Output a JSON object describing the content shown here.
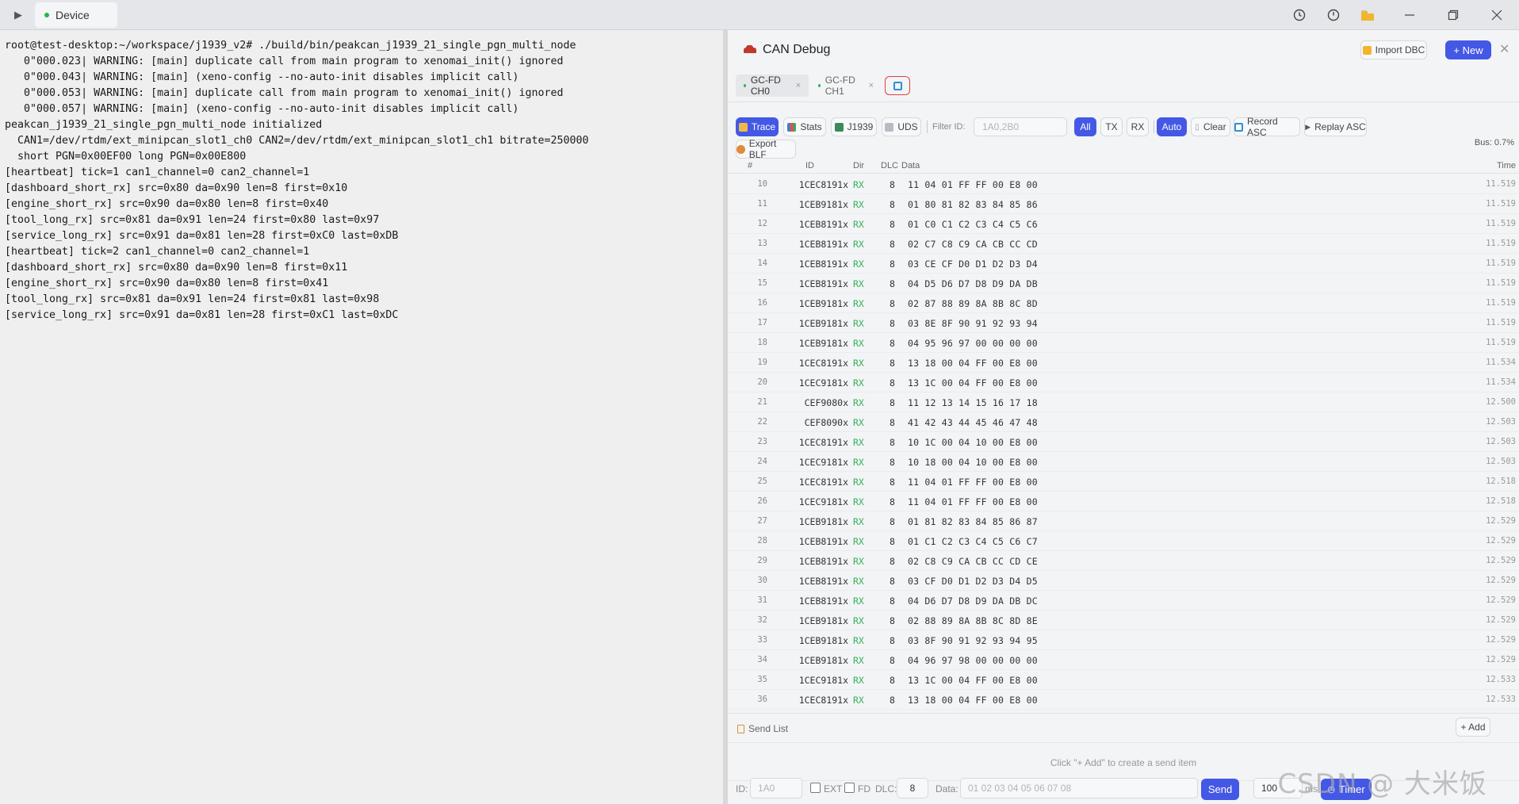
{
  "topbar": {
    "device_tab_label": "Device"
  },
  "terminal": {
    "lines": [
      "root@test-desktop:~/workspace/j1939_v2# ./build/bin/peakcan_j1939_21_single_pgn_multi_node",
      "   0\"000.023| WARNING: [main] duplicate call from main program to xenomai_init() ignored",
      "   0\"000.043| WARNING: [main] (xeno-config --no-auto-init disables implicit call)",
      "   0\"000.053| WARNING: [main] duplicate call from main program to xenomai_init() ignored",
      "   0\"000.057| WARNING: [main] (xeno-config --no-auto-init disables implicit call)",
      "peakcan_j1939_21_single_pgn_multi_node initialized",
      "  CAN1=/dev/rtdm/ext_minipcan_slot1_ch0 CAN2=/dev/rtdm/ext_minipcan_slot1_ch1 bitrate=250000",
      "  short PGN=0x00EF00 long PGN=0x00E800",
      "[heartbeat] tick=1 can1_channel=0 can2_channel=1",
      "[dashboard_short_rx] src=0x80 da=0x90 len=8 first=0x10",
      "[engine_short_rx] src=0x90 da=0x80 len=8 first=0x40",
      "[tool_long_rx] src=0x81 da=0x91 len=24 first=0x80 last=0x97",
      "[service_long_rx] src=0x91 da=0x81 len=28 first=0xC0 last=0xDB",
      "[heartbeat] tick=2 can1_channel=0 can2_channel=1",
      "[dashboard_short_rx] src=0x80 da=0x90 len=8 first=0x11",
      "[engine_short_rx] src=0x90 da=0x80 len=8 first=0x41",
      "[tool_long_rx] src=0x81 da=0x91 len=24 first=0x81 last=0x98",
      "[service_long_rx] src=0x91 da=0x81 len=28 first=0xC1 last=0xDC"
    ]
  },
  "panel": {
    "title": "CAN Debug",
    "import_dbc": "Import DBC",
    "new_btn": "+ New",
    "tabs": [
      {
        "label": "GC-FD CH0",
        "active": true
      },
      {
        "label": "GC-FD CH1",
        "active": false
      }
    ],
    "toolbar": {
      "trace": "Trace",
      "stats": "Stats",
      "j1939": "J1939",
      "uds": "UDS",
      "filter_label": "Filter ID:",
      "filter_placeholder": "1A0,2B0",
      "all": "All",
      "tx": "TX",
      "rx": "RX",
      "auto": "Auto",
      "clear": "Clear",
      "record_asc": "Record ASC",
      "replay_asc": "Replay ASC",
      "export_blf": "Export BLF",
      "bus_load": "Bus: 0.7%"
    },
    "table_headers": {
      "num": "#",
      "id": "ID",
      "dir": "Dir",
      "dlc": "DLC",
      "data": "Data",
      "time": "Time"
    },
    "rows": [
      {
        "n": "10",
        "id": "1CEC8191x",
        "dir": "RX",
        "dlc": "8",
        "data": "11 04 01 FF FF 00 E8 00",
        "time": "11.519"
      },
      {
        "n": "11",
        "id": "1CEB9181x",
        "dir": "RX",
        "dlc": "8",
        "data": "01 80 81 82 83 84 85 86",
        "time": "11.519"
      },
      {
        "n": "12",
        "id": "1CEB8191x",
        "dir": "RX",
        "dlc": "8",
        "data": "01 C0 C1 C2 C3 C4 C5 C6",
        "time": "11.519"
      },
      {
        "n": "13",
        "id": "1CEB8191x",
        "dir": "RX",
        "dlc": "8",
        "data": "02 C7 C8 C9 CA CB CC CD",
        "time": "11.519"
      },
      {
        "n": "14",
        "id": "1CEB8191x",
        "dir": "RX",
        "dlc": "8",
        "data": "03 CE CF D0 D1 D2 D3 D4",
        "time": "11.519"
      },
      {
        "n": "15",
        "id": "1CEB8191x",
        "dir": "RX",
        "dlc": "8",
        "data": "04 D5 D6 D7 D8 D9 DA DB",
        "time": "11.519"
      },
      {
        "n": "16",
        "id": "1CEB9181x",
        "dir": "RX",
        "dlc": "8",
        "data": "02 87 88 89 8A 8B 8C 8D",
        "time": "11.519"
      },
      {
        "n": "17",
        "id": "1CEB9181x",
        "dir": "RX",
        "dlc": "8",
        "data": "03 8E 8F 90 91 92 93 94",
        "time": "11.519"
      },
      {
        "n": "18",
        "id": "1CEB9181x",
        "dir": "RX",
        "dlc": "8",
        "data": "04 95 96 97 00 00 00 00",
        "time": "11.519"
      },
      {
        "n": "19",
        "id": "1CEC8191x",
        "dir": "RX",
        "dlc": "8",
        "data": "13 18 00 04 FF 00 E8 00",
        "time": "11.534"
      },
      {
        "n": "20",
        "id": "1CEC9181x",
        "dir": "RX",
        "dlc": "8",
        "data": "13 1C 00 04 FF 00 E8 00",
        "time": "11.534"
      },
      {
        "n": "21",
        "id": "CEF9080x",
        "dir": "RX",
        "dlc": "8",
        "data": "11 12 13 14 15 16 17 18",
        "time": "12.500"
      },
      {
        "n": "22",
        "id": "CEF8090x",
        "dir": "RX",
        "dlc": "8",
        "data": "41 42 43 44 45 46 47 48",
        "time": "12.503"
      },
      {
        "n": "23",
        "id": "1CEC8191x",
        "dir": "RX",
        "dlc": "8",
        "data": "10 1C 00 04 10 00 E8 00",
        "time": "12.503"
      },
      {
        "n": "24",
        "id": "1CEC9181x",
        "dir": "RX",
        "dlc": "8",
        "data": "10 18 00 04 10 00 E8 00",
        "time": "12.503"
      },
      {
        "n": "25",
        "id": "1CEC8191x",
        "dir": "RX",
        "dlc": "8",
        "data": "11 04 01 FF FF 00 E8 00",
        "time": "12.518"
      },
      {
        "n": "26",
        "id": "1CEC9181x",
        "dir": "RX",
        "dlc": "8",
        "data": "11 04 01 FF FF 00 E8 00",
        "time": "12.518"
      },
      {
        "n": "27",
        "id": "1CEB9181x",
        "dir": "RX",
        "dlc": "8",
        "data": "01 81 82 83 84 85 86 87",
        "time": "12.529"
      },
      {
        "n": "28",
        "id": "1CEB8191x",
        "dir": "RX",
        "dlc": "8",
        "data": "01 C1 C2 C3 C4 C5 C6 C7",
        "time": "12.529"
      },
      {
        "n": "29",
        "id": "1CEB8191x",
        "dir": "RX",
        "dlc": "8",
        "data": "02 C8 C9 CA CB CC CD CE",
        "time": "12.529"
      },
      {
        "n": "30",
        "id": "1CEB8191x",
        "dir": "RX",
        "dlc": "8",
        "data": "03 CF D0 D1 D2 D3 D4 D5",
        "time": "12.529"
      },
      {
        "n": "31",
        "id": "1CEB8191x",
        "dir": "RX",
        "dlc": "8",
        "data": "04 D6 D7 D8 D9 DA DB DC",
        "time": "12.529"
      },
      {
        "n": "32",
        "id": "1CEB9181x",
        "dir": "RX",
        "dlc": "8",
        "data": "02 88 89 8A 8B 8C 8D 8E",
        "time": "12.529"
      },
      {
        "n": "33",
        "id": "1CEB9181x",
        "dir": "RX",
        "dlc": "8",
        "data": "03 8F 90 91 92 93 94 95",
        "time": "12.529"
      },
      {
        "n": "34",
        "id": "1CEB9181x",
        "dir": "RX",
        "dlc": "8",
        "data": "04 96 97 98 00 00 00 00",
        "time": "12.529"
      },
      {
        "n": "35",
        "id": "1CEC9181x",
        "dir": "RX",
        "dlc": "8",
        "data": "13 1C 00 04 FF 00 E8 00",
        "time": "12.533"
      },
      {
        "n": "36",
        "id": "1CEC8191x",
        "dir": "RX",
        "dlc": "8",
        "data": "13 18 00 04 FF 00 E8 00",
        "time": "12.533"
      }
    ],
    "send_list": {
      "title": "Send List",
      "add": "+ Add",
      "empty_hint": "Click \"+ Add\" to create a send item"
    },
    "send_bar": {
      "id_label": "ID:",
      "id_placeholder": "1A0",
      "ext_label": "EXT",
      "fd_label": "FD",
      "dlc_label": "DLC:",
      "dlc_value": "8",
      "data_label": "Data:",
      "data_placeholder": "01 02 03 04 05 06 07 08",
      "send": "Send",
      "period_value": "100",
      "ms": "ms",
      "timer": "Timer"
    },
    "watermark": "CSDN @ 大米饭"
  }
}
